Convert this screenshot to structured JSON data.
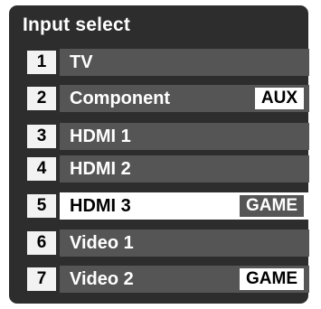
{
  "menu": {
    "title": "Input select",
    "items": [
      {
        "number": "1",
        "label": "TV",
        "tag": ""
      },
      {
        "number": "2",
        "label": "Component",
        "tag": "AUX"
      },
      {
        "number": "3",
        "label": "HDMI 1",
        "tag": ""
      },
      {
        "number": "4",
        "label": "HDMI 2",
        "tag": ""
      },
      {
        "number": "5",
        "label": "HDMI 3",
        "tag": "GAME",
        "selected": true
      },
      {
        "number": "6",
        "label": "Video 1",
        "tag": ""
      },
      {
        "number": "7",
        "label": "Video 2",
        "tag": "GAME"
      }
    ]
  },
  "colors": {
    "panel": "#2d2d2d",
    "item": "#555555",
    "selected_item": "#ffffff",
    "text": "#ffffff"
  }
}
